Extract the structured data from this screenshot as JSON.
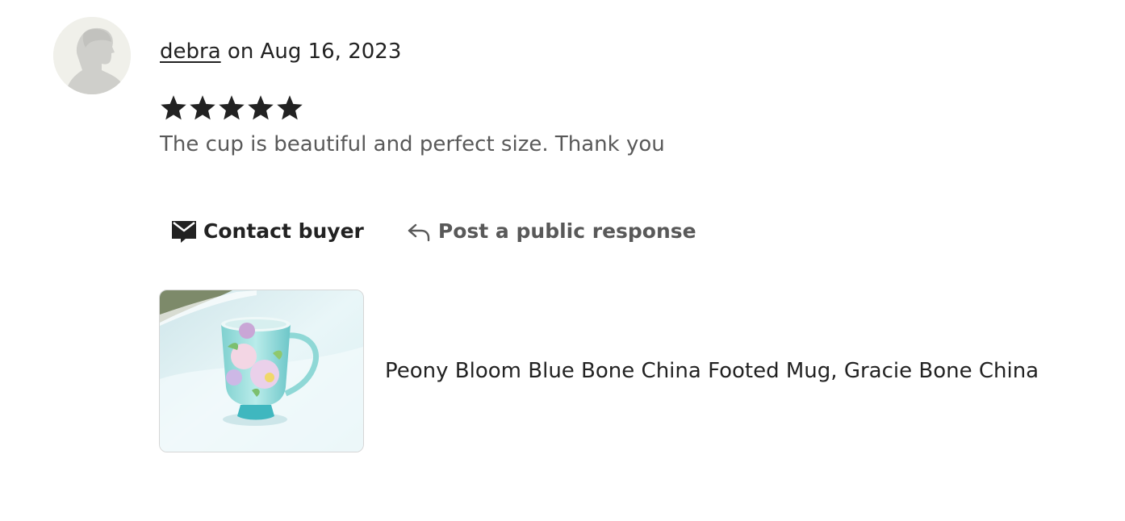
{
  "review": {
    "author": "debra",
    "date_text": " on Aug 16, 2023",
    "rating": 5,
    "rating_max": 5,
    "text": "The cup is beautiful and perfect size. Thank you"
  },
  "actions": {
    "contact_label": "Contact buyer",
    "contact_icon": "envelope-icon",
    "respond_label": "Post a public response",
    "respond_icon": "reply-arrow-icon"
  },
  "product": {
    "title": "Peony Bloom Blue Bone China Footed Mug, Gracie Bone China"
  },
  "colors": {
    "text_primary": "#222222",
    "text_secondary": "#595959",
    "avatar_bg": "#f0f0ea",
    "star": "#222222",
    "thumb_border": "#d6d6d6"
  }
}
